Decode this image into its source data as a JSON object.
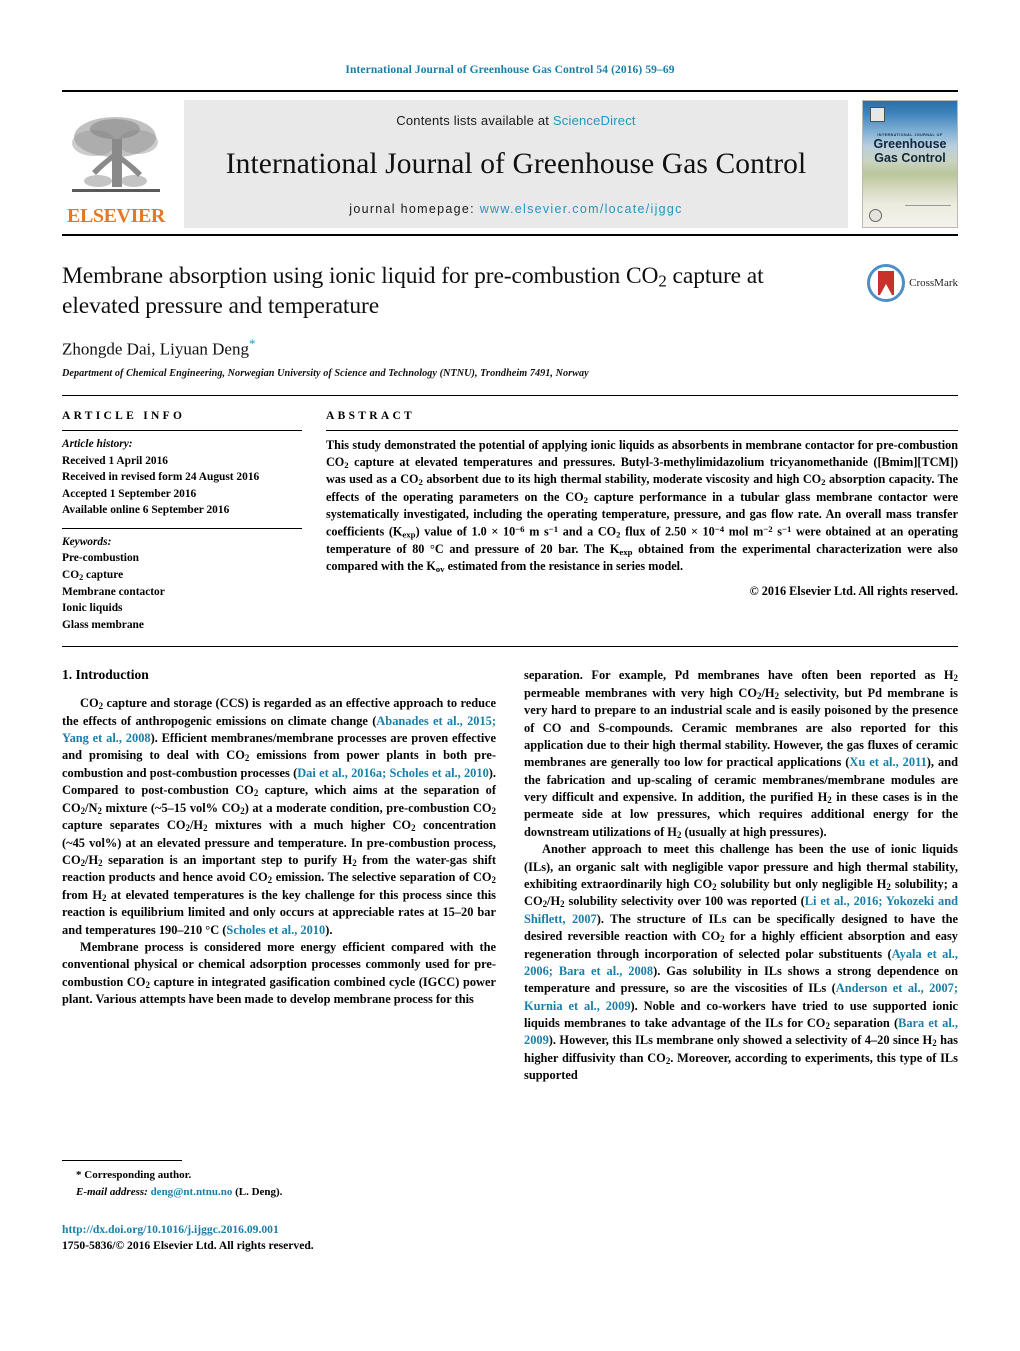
{
  "running_head": "International Journal of Greenhouse Gas Control 54 (2016) 59–69",
  "masthead": {
    "contents_prefix": "Contents lists available at",
    "sciencedirect": "ScienceDirect",
    "journal_title": "International Journal of Greenhouse Gas Control",
    "homepage_prefix": "journal homepage:",
    "homepage_url": "www.elsevier.com/locate/ijggc",
    "publisher": "ELSEVIER",
    "cover": {
      "superline": "INTERNATIONAL JOURNAL OF",
      "line1": "Greenhouse",
      "line2": "Gas Control"
    },
    "link_color": "#2196c4"
  },
  "article": {
    "title": "Membrane absorption using ionic liquid for pre-combustion CO2 capture at elevated pressure and temperature",
    "title_part1": "Membrane absorption using ionic liquid for pre-combustion CO",
    "title_sub": "2",
    "title_part2": " capture at elevated pressure and temperature",
    "authors": "Zhongde Dai, Liyuan Deng",
    "corresponding_marker": "*",
    "affiliation": "Department of Chemical Engineering, Norwegian University of Science and Technology (NTNU), Trondheim 7491, Norway",
    "crossmark_label": "CrossMark"
  },
  "article_info": {
    "heading": "ARTICLE INFO",
    "history_label": "Article history:",
    "history": [
      "Received 1 April 2016",
      "Received in revised form 24 August 2016",
      "Accepted 1 September 2016",
      "Available online 6 September 2016"
    ],
    "keywords_label": "Keywords:",
    "keywords": [
      "Pre-combustion",
      "CO2 capture",
      "Membrane contactor",
      "Ionic liquids",
      "Glass membrane"
    ]
  },
  "abstract": {
    "heading": "ABSTRACT",
    "copyright": "© 2016 Elsevier Ltd. All rights reserved."
  },
  "body": {
    "section1_heading": "1.  Introduction"
  },
  "footnote": {
    "corresponding": "* Corresponding author.",
    "email_label": "E-mail address:",
    "email": "deng@nt.ntnu.no",
    "email_suffix": "(L. Deng)."
  },
  "footer": {
    "doi": "http://dx.doi.org/10.1016/j.ijggc.2016.09.001",
    "issn_line": "1750-5836/© 2016 Elsevier Ltd. All rights reserved."
  },
  "colors": {
    "link": "#1a7fa8",
    "accent_orange": "#E87722",
    "crossmark_red": "#C8322A",
    "crossmark_blue": "#4C90C8"
  }
}
